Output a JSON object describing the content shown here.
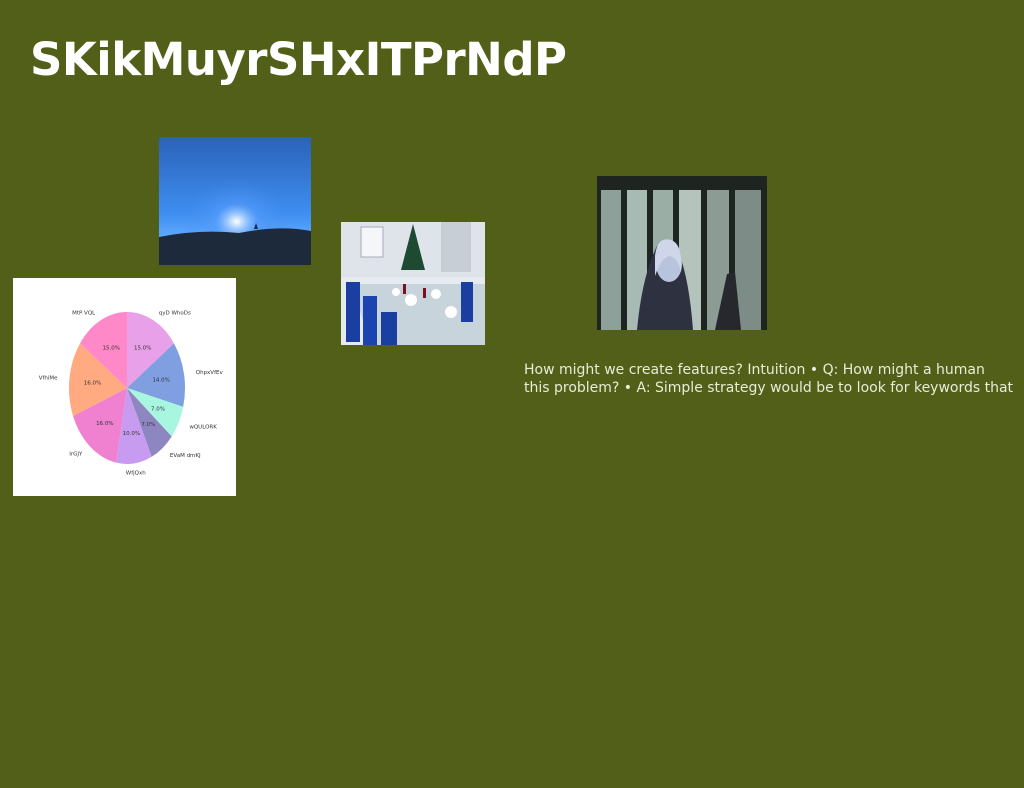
{
  "page": {
    "title": "SKikMuyrSHxITPrNdP",
    "background": "#525f18",
    "text_block": "How might we create features? Intuition • Q: How might a human\nthis problem? • A: Simple strategy would be to look for keywords that"
  },
  "images": [
    {
      "name": "blue-sunset-photo"
    },
    {
      "name": "dinner-table-photo"
    },
    {
      "name": "woman-window-photo"
    }
  ],
  "chart_data": {
    "type": "pie",
    "labels": [
      "qyD WhoDs",
      "QhpxVfEv",
      "wQULORK",
      "EVaM dmKJ",
      "WfjQxh",
      "IrGJY",
      "VfhiMe",
      "MtP VQL"
    ],
    "values": [
      15.0,
      14.0,
      7.0,
      7.0,
      10.0,
      16.0,
      16.0,
      15.0
    ],
    "pct_labels": [
      "15.0%",
      "14.0%",
      "7.0%",
      "7.0%",
      "10.0%",
      "16.0%",
      "16.0%",
      "15.0%"
    ],
    "colors": [
      "#e8a0e8",
      "#7f9fe0",
      "#a8f5e0",
      "#8d86c0",
      "#c79cf0",
      "#f080d0",
      "#ffaa80",
      "#ff88c8"
    ],
    "title": "",
    "legend": "none"
  }
}
